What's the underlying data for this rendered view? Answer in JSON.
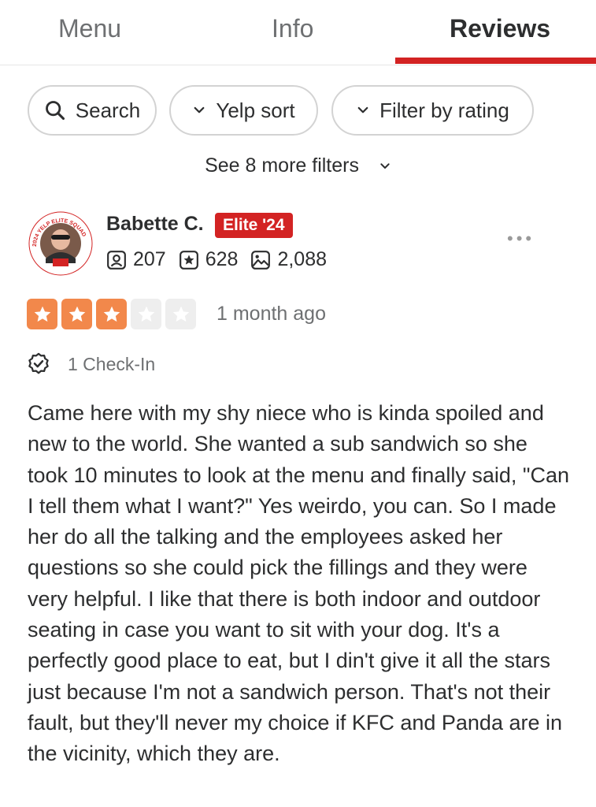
{
  "tabs": [
    {
      "label": "Menu",
      "active": false
    },
    {
      "label": "Info",
      "active": false
    },
    {
      "label": "Reviews",
      "active": true
    }
  ],
  "colors": {
    "accent": "#d32323",
    "star_filled": "#f2884b",
    "star_empty": "#eeeeee",
    "muted_text": "#6e7072"
  },
  "filters": {
    "search_label": "Search",
    "sort_label": "Yelp sort",
    "rating_label": "Filter by rating",
    "more_filters_label": "See 8 more filters"
  },
  "review": {
    "user": {
      "name": "Babette C.",
      "badge": "Elite '24",
      "avatar_ring_text": "2024 YELP ELITE SQUAD",
      "friends_count": "207",
      "reviews_count": "628",
      "photos_count": "2,088"
    },
    "rating": 3,
    "rating_max": 5,
    "date": "1 month ago",
    "checkins": "1 Check-In",
    "text": "Came here with my shy niece who is kinda spoiled and new to the world. She wanted a sub sandwich so she took 10 minutes to look at the menu and finally said, \"Can I tell them what I want?\"  Yes weirdo, you can.  So I made her do all the talking and the employees asked her questions so she could pick the fillings and they were very helpful. I like that there is both indoor and outdoor seating in case you want to sit with your dog.  It's a perfectly good place to eat, but I din't give it all the stars just because I'm not a sandwich person. That's not their fault, but they'll never my choice if KFC and Panda are in the vicinity, which they are."
  },
  "icons": [
    "search-icon",
    "chevron-down-icon",
    "friends-icon",
    "star-review-icon",
    "photo-icon",
    "checkin-icon",
    "more-options-icon"
  ]
}
